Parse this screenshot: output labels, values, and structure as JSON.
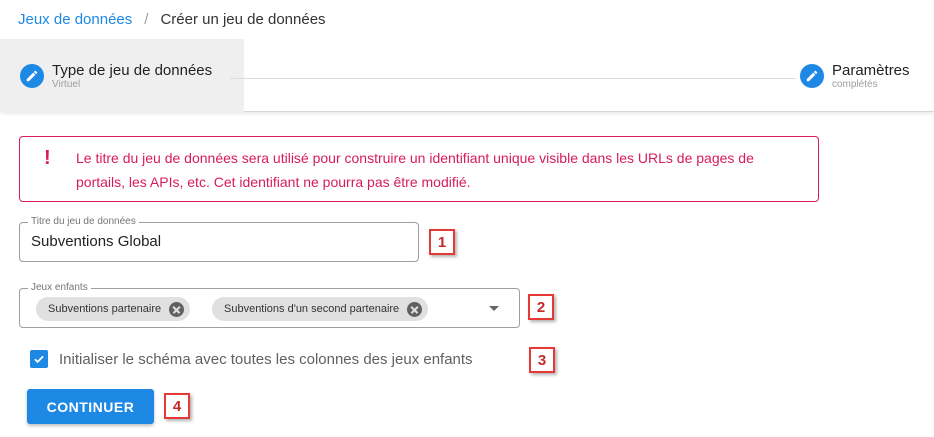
{
  "breadcrumb": {
    "root": "Jeux de données",
    "separator": "/",
    "current": "Créer un jeu de données"
  },
  "stepper": {
    "steps": [
      {
        "title": "Type de jeu de données",
        "subtitle": "Virtuel",
        "icon": "pencil-icon",
        "active": true
      },
      {
        "title": "Paramètres",
        "subtitle": "complétés",
        "icon": "pencil-icon",
        "active": false
      }
    ]
  },
  "alert": {
    "icon": "!",
    "text": "Le titre du jeu de données sera utilisé pour construire un identifiant unique visible dans les URLs de pages de portails, les APIs, etc. Cet identifiant ne pourra pas être modifié."
  },
  "form": {
    "title_field": {
      "label": "Titre du jeu de données",
      "value": "Subventions Global"
    },
    "children_field": {
      "label": "Jeux enfants",
      "chips": [
        "Subventions partenaire",
        "Subventions d'un second partenaire"
      ]
    },
    "checkbox": {
      "label": "Initialiser le schéma avec toutes les colonnes des jeux enfants",
      "checked": true
    },
    "submit_label": "CONTINUER"
  },
  "markers": [
    "1",
    "2",
    "3",
    "4"
  ],
  "colors": {
    "primary": "#1e88e5",
    "alert": "#d81b60",
    "marker": "#e53935"
  }
}
